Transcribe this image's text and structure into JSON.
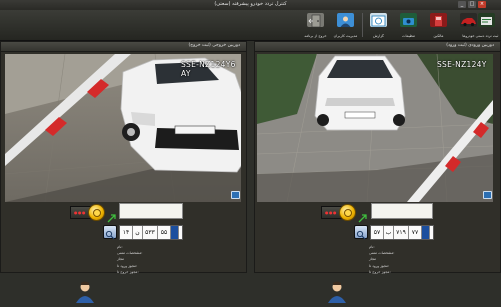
{
  "window": {
    "title": "کنترل تردد خودرو پیشرفته (سعتی)",
    "controls": [
      "×",
      "□",
      "_"
    ]
  },
  "toolbar": {
    "buttons": [
      {
        "label": "خروج از برنامه",
        "icon": "exit-door-icon",
        "color": "#c8c8c8"
      },
      {
        "label": "مدیریت کاربران",
        "icon": "users-icon",
        "color": "#3d8fd6"
      },
      {
        "label": "گزارش",
        "icon": "report-icon",
        "color": "#1c7ab8"
      },
      {
        "label": "تنظیمات",
        "icon": "camera-settings-icon",
        "color": "#5b5b52"
      },
      {
        "label": "مالکین",
        "icon": "owners-icon",
        "color": "#2f74c2"
      },
      {
        "label": "اطلاعات پایه",
        "icon": "database-icon",
        "color": "#2b6cb0"
      },
      {
        "label": "خودروها",
        "icon": "cars-icon",
        "color": "#c02121"
      },
      {
        "label": "ثبت تردد دستی",
        "icon": "manual-entry-icon",
        "color": "#2a7a3a"
      }
    ]
  },
  "panels": [
    {
      "title": "دوربین خروجی (ثبت خروج)",
      "plate_overlay": "SSE-NZ124Y6 AY",
      "plate": {
        "two_digit": "۵۵",
        "three_digit": "۵۳۳",
        "letter": "ن",
        "region": "۱۴"
      },
      "info": {
        "owner_label": "نام:",
        "type_label": "مشخصات ممنی:",
        "row3": "مجاز",
        "row4": "مجوز ورود تا:",
        "row5": "مجوز خروج تا:"
      }
    },
    {
      "title": "دوربین ورودی (ثبت ورود)",
      "plate_overlay": "SSE-NZ124Y",
      "plate": {
        "two_digit": "۷۷",
        "three_digit": "۷۱۹",
        "letter": "ب",
        "region": "۵۷"
      },
      "info": {
        "owner_label": "نام:",
        "type_label": "مشخصات ممنی:",
        "row3": "مجاز",
        "row4": "مجوز ورود تا:",
        "row5": "مجوز خروج تا:"
      }
    }
  ]
}
